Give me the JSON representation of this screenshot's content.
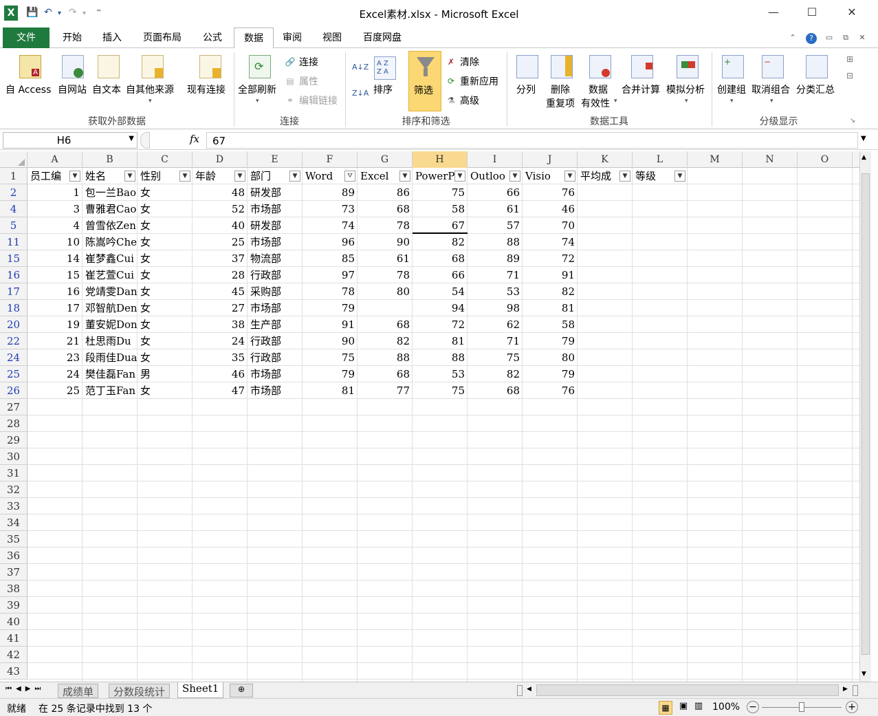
{
  "window": {
    "title": "Excel素材.xlsx - Microsoft Excel"
  },
  "tabs": [
    "文件",
    "开始",
    "插入",
    "页面布局",
    "公式",
    "数据",
    "审阅",
    "视图",
    "百度网盘"
  ],
  "ribbon": {
    "get_external": {
      "access": "自 Access",
      "web": "自网站",
      "text": "自文本",
      "other": "自其他来源",
      "existing": "现有连接",
      "group": "获取外部数据"
    },
    "connections": {
      "refresh_all": "全部刷新",
      "connect": "连接",
      "props": "属性",
      "edit_links": "编辑链接",
      "group": "连接"
    },
    "sort_filter": {
      "sort": "排序",
      "filter": "筛选",
      "clear": "清除",
      "reapply": "重新应用",
      "advanced": "高级",
      "group": "排序和筛选"
    },
    "data_tools": {
      "split": "分列",
      "remove_dup_1": "删除",
      "remove_dup_2": "重复项",
      "validation_1": "数据",
      "validation_2": "有效性",
      "consolidate": "合并计算",
      "whatif": "模拟分析",
      "group": "数据工具"
    },
    "outline": {
      "group_btn": "创建组",
      "ungroup": "取消组合",
      "subtotal": "分类汇总",
      "group": "分级显示"
    }
  },
  "formula_bar": {
    "name_box": "H6",
    "fx": "fx",
    "value": "67"
  },
  "columns": [
    "A",
    "B",
    "C",
    "D",
    "E",
    "F",
    "G",
    "H",
    "I",
    "J",
    "K",
    "L",
    "M",
    "N",
    "O"
  ],
  "header_row": [
    "员工编",
    "姓名",
    "性别",
    "年龄",
    "部门",
    "Word",
    "Excel",
    "PowerP",
    "Outloo",
    "Visio",
    "平均成",
    "等级"
  ],
  "rows": [
    {
      "r": "2",
      "id": "1",
      "name": "包一兰Bao",
      "sex": "女",
      "age": "48",
      "dept": "研发部",
      "word": "89",
      "excel": "86",
      "ppt": "75",
      "outlook": "66",
      "visio": "76"
    },
    {
      "r": "4",
      "id": "3",
      "name": "曹雅君Cao",
      "sex": "女",
      "age": "52",
      "dept": "市场部",
      "word": "73",
      "excel": "68",
      "ppt": "58",
      "outlook": "61",
      "visio": "46"
    },
    {
      "r": "5",
      "id": "4",
      "name": "曾雪依Zen",
      "sex": "女",
      "age": "40",
      "dept": "研发部",
      "word": "74",
      "excel": "78",
      "ppt": "67",
      "outlook": "57",
      "visio": "70"
    },
    {
      "r": "11",
      "id": "10",
      "name": "陈嵩吟Che",
      "sex": "女",
      "age": "25",
      "dept": "市场部",
      "word": "96",
      "excel": "90",
      "ppt": "82",
      "outlook": "88",
      "visio": "74"
    },
    {
      "r": "15",
      "id": "14",
      "name": "崔梦鑫Cui",
      "sex": "女",
      "age": "37",
      "dept": "物流部",
      "word": "85",
      "excel": "61",
      "ppt": "68",
      "outlook": "89",
      "visio": "72"
    },
    {
      "r": "16",
      "id": "15",
      "name": "崔艺萱Cui",
      "sex": "女",
      "age": "28",
      "dept": "行政部",
      "word": "97",
      "excel": "78",
      "ppt": "66",
      "outlook": "71",
      "visio": "91"
    },
    {
      "r": "17",
      "id": "16",
      "name": "党靖雯Dan",
      "sex": "女",
      "age": "45",
      "dept": "采购部",
      "word": "78",
      "excel": "80",
      "ppt": "54",
      "outlook": "53",
      "visio": "82"
    },
    {
      "r": "18",
      "id": "17",
      "name": "邓智航Den",
      "sex": "女",
      "age": "27",
      "dept": "市场部",
      "word": "79",
      "excel": "",
      "ppt": "94",
      "outlook": "98",
      "visio": "81"
    },
    {
      "r": "20",
      "id": "19",
      "name": "董安妮Don",
      "sex": "女",
      "age": "38",
      "dept": "生产部",
      "word": "91",
      "excel": "68",
      "ppt": "72",
      "outlook": "62",
      "visio": "58"
    },
    {
      "r": "22",
      "id": "21",
      "name": "杜思雨Du",
      "sex": "女",
      "age": "24",
      "dept": "行政部",
      "word": "90",
      "excel": "82",
      "ppt": "81",
      "outlook": "71",
      "visio": "79"
    },
    {
      "r": "24",
      "id": "23",
      "name": "段雨佳Dua",
      "sex": "女",
      "age": "35",
      "dept": "行政部",
      "word": "75",
      "excel": "88",
      "ppt": "88",
      "outlook": "75",
      "visio": "80"
    },
    {
      "r": "25",
      "id": "24",
      "name": "樊佳磊Fan",
      "sex": "男",
      "age": "46",
      "dept": "市场部",
      "word": "79",
      "excel": "68",
      "ppt": "53",
      "outlook": "82",
      "visio": "79"
    },
    {
      "r": "26",
      "id": "25",
      "name": "范丁玉Fan",
      "sex": "女",
      "age": "47",
      "dept": "市场部",
      "word": "81",
      "excel": "77",
      "ppt": "75",
      "outlook": "68",
      "visio": "76"
    }
  ],
  "empty_rows": [
    "27",
    "28",
    "29",
    "30",
    "31",
    "32",
    "33",
    "34",
    "35",
    "36",
    "37",
    "38",
    "39",
    "40",
    "41",
    "42",
    "43"
  ],
  "sheets": [
    "成绩单",
    "分数段统计",
    "Sheet1"
  ],
  "status": {
    "ready": "就绪",
    "filter_msg": "在 25 条记录中找到 13 个",
    "zoom": "100%"
  },
  "colors": {
    "file_tab": "#1f7a3e",
    "selected_header": "#f9d98f",
    "filtered_row_num": "#1f3cb5"
  }
}
